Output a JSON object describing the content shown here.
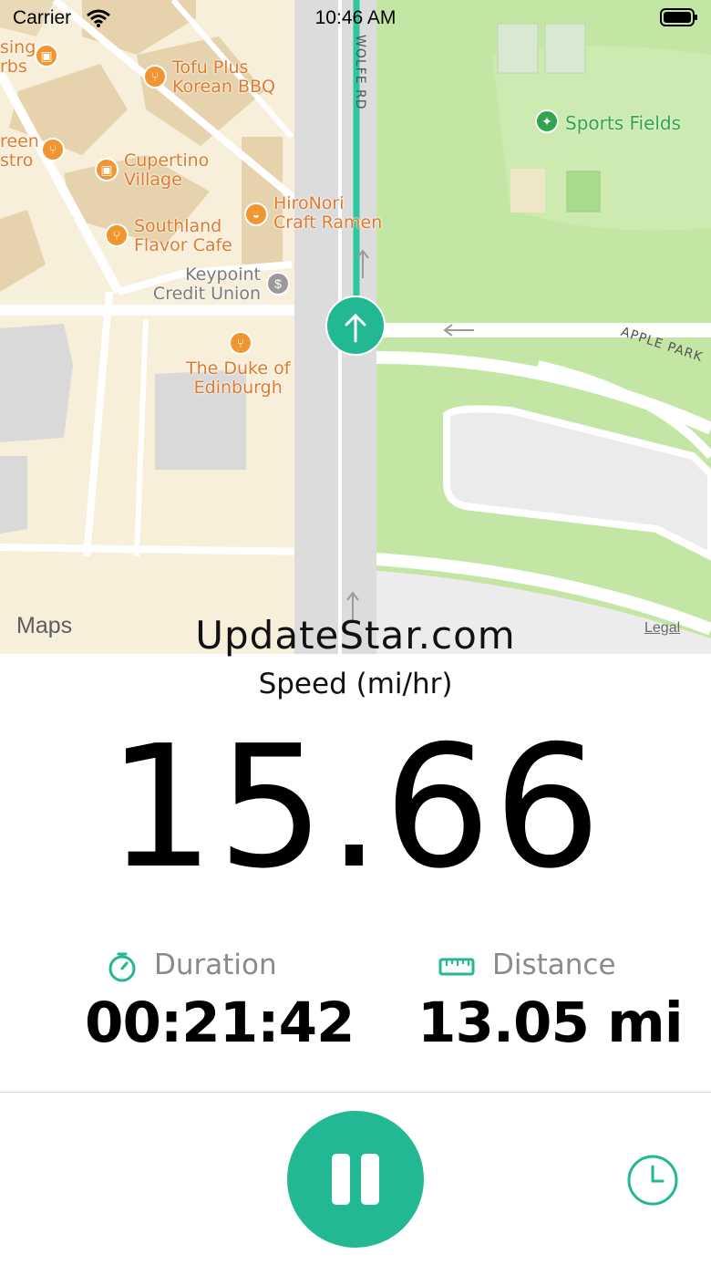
{
  "status_bar": {
    "carrier": "Carrier",
    "time": "10:46 AM"
  },
  "map": {
    "pois": [
      {
        "label": "sing\nrbs",
        "icon": "shopping-bag-icon"
      },
      {
        "label": "Tofu Plus\nKorean BBQ",
        "icon": "restaurant-icon"
      },
      {
        "label": "reen\nstro",
        "icon": "restaurant-icon"
      },
      {
        "label": "Cupertino\nVillage",
        "icon": "shopping-bag-icon"
      },
      {
        "label": "HiroNori\nCraft Ramen",
        "icon": "ramen-icon"
      },
      {
        "label": "Southland\nFlavor Cafe",
        "icon": "restaurant-icon"
      },
      {
        "label": "Keypoint\nCredit Union",
        "icon": "bank-icon"
      },
      {
        "label": "The Duke of\nEdinburgh",
        "icon": "restaurant-icon"
      }
    ],
    "park_label": "Sports Fields",
    "road_labels": {
      "wolfe": "WOLFE RD",
      "apple_park": "APPLE PARK"
    },
    "attribution": "Maps",
    "legal": "Legal"
  },
  "watermark": "UpdateStar.com",
  "speed": {
    "label": "Speed (mi/hr)",
    "value": "15.66"
  },
  "duration": {
    "label": "Duration",
    "value": "00:21:42",
    "icon": "timer-icon"
  },
  "distance": {
    "label": "Distance",
    "value": "13.05 mi",
    "icon": "ruler-icon"
  },
  "controls": {
    "pause_icon": "pause-icon",
    "history_icon": "clock-icon"
  },
  "colors": {
    "accent": "#21b893",
    "park": "#bfe3a0",
    "poi": "#e07a2c"
  }
}
